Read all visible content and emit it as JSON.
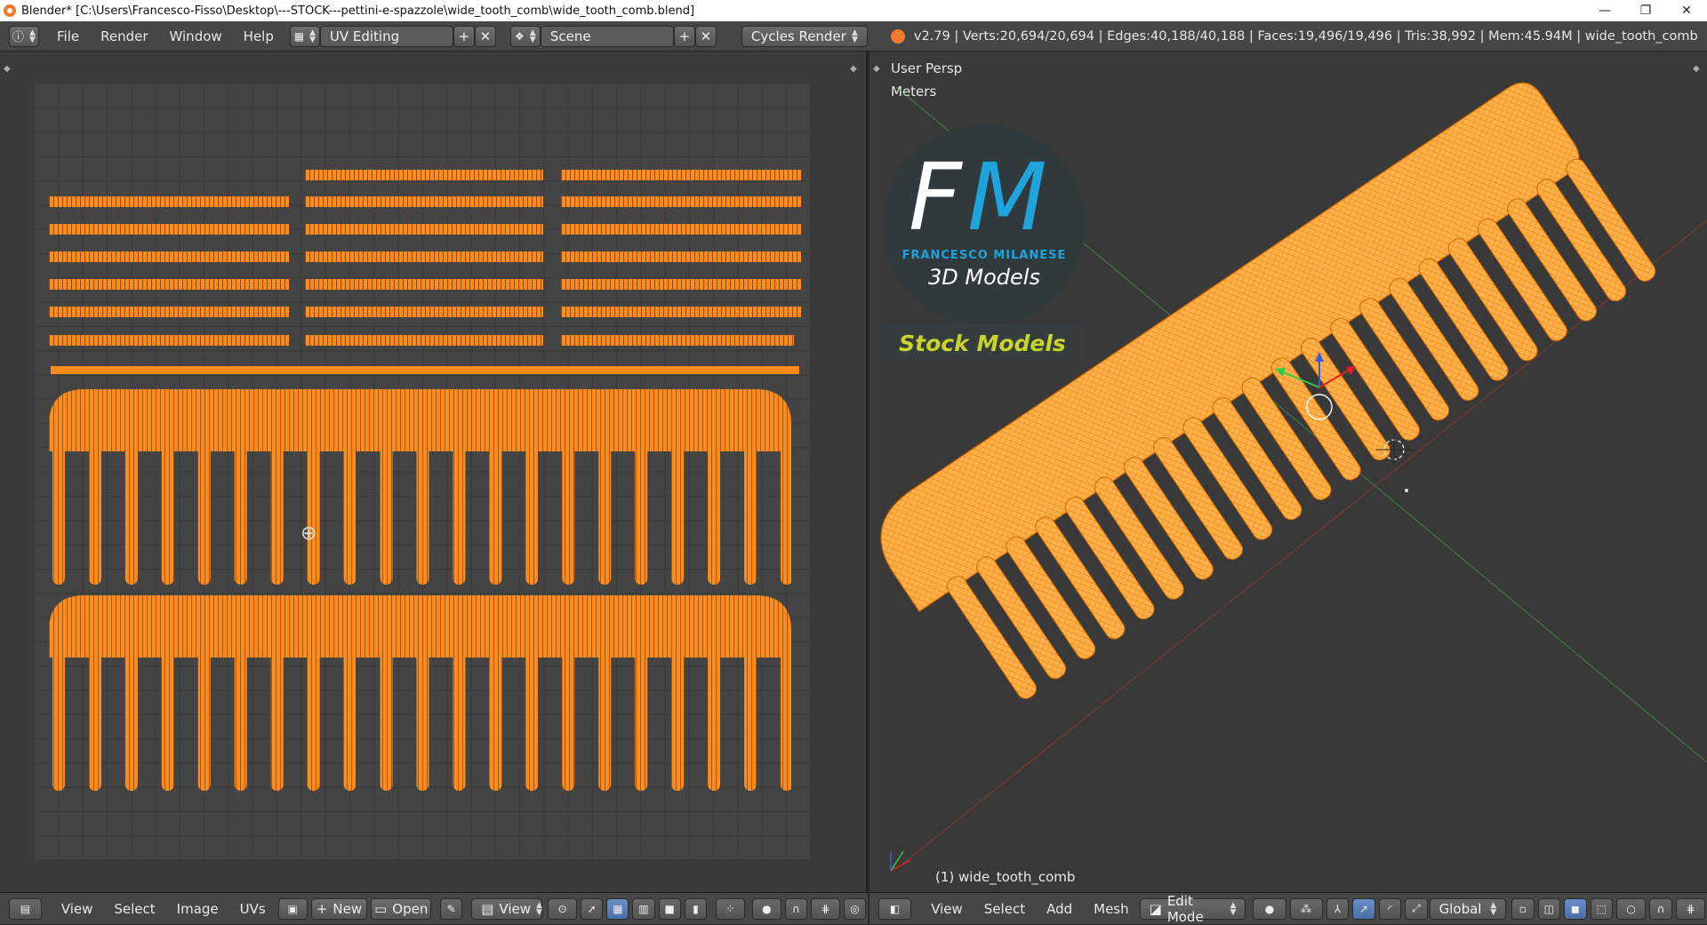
{
  "window": {
    "title": "Blender* [C:\\Users\\Francesco-Fisso\\Desktop\\---STOCK---pettini-e-spazzole\\wide_tooth_comb\\wide_tooth_comb.blend]",
    "minimize_glyph": "—",
    "maximize_glyph": "❐",
    "close_glyph": "✕"
  },
  "info_header": {
    "menus": [
      "File",
      "Render",
      "Window",
      "Help"
    ],
    "screen_layout": "UV Editing",
    "scene": "Scene",
    "render_engine": "Cycles Render",
    "stats": "v2.79 | Verts:20,694/20,694 | Edges:40,188/40,188 | Faces:19,496/19,496 | Tris:38,992 | Mem:45.94M | wide_tooth_comb"
  },
  "uv_editor": {
    "menus": [
      "View",
      "Select",
      "Image",
      "UVs"
    ],
    "new_label": "New",
    "open_label": "Open",
    "view_label": "View"
  },
  "viewport": {
    "view_name": "User Persp",
    "units": "Meters",
    "object_label": "(1) wide_tooth_comb",
    "menus": [
      "View",
      "Select",
      "Add",
      "Mesh"
    ],
    "mode": "Edit Mode",
    "orientation": "Global"
  },
  "logo": {
    "letter_f": "F",
    "letter_m": "M",
    "brand": "FRANCESCO MILANESE",
    "subtitle": "3D Models",
    "banner": "Stock Models"
  },
  "colors": {
    "mesh_orange": "#ff8c1a",
    "logo_blue": "#1fa3dc",
    "banner_yellow": "#c8d42a"
  }
}
